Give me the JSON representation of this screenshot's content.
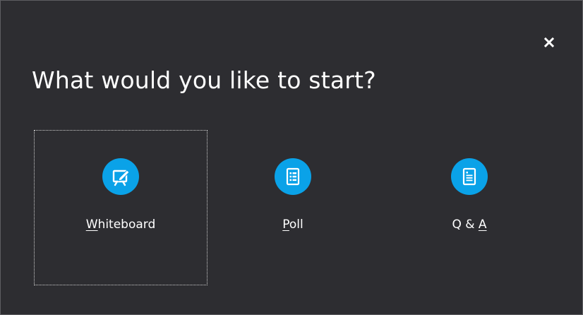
{
  "dialog": {
    "title": "What would you like to start?",
    "options": [
      {
        "label_access": "W",
        "label_rest": "hiteboard",
        "icon": "whiteboard-icon"
      },
      {
        "label_access": "P",
        "label_rest": "oll",
        "icon": "poll-icon"
      },
      {
        "label_prefix": "Q & ",
        "label_access": "A",
        "icon": "qa-icon"
      }
    ]
  },
  "colors": {
    "background": "#2d2d31",
    "accent": "#0aa2e8",
    "text": "#ffffff"
  }
}
